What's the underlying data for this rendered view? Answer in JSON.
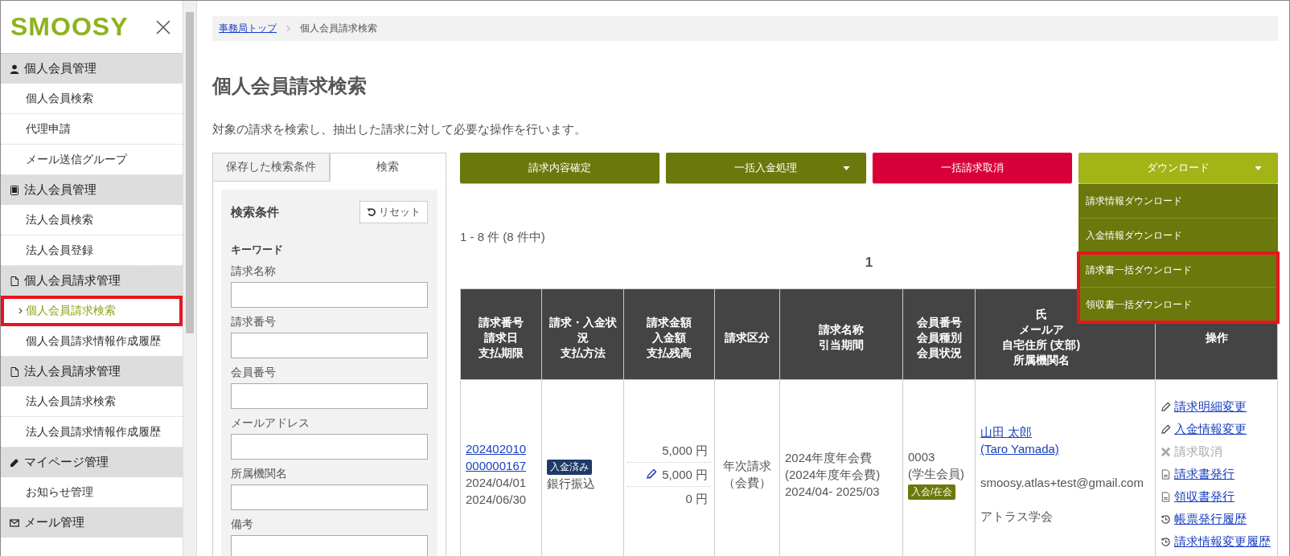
{
  "sidebar": {
    "logo": "SMOOSY",
    "sections": [
      {
        "title": "個人会員管理",
        "items": [
          {
            "label": "個人会員検索",
            "selected": false,
            "highlighted": false
          },
          {
            "label": "代理申請",
            "selected": false,
            "highlighted": false
          },
          {
            "label": "メール送信グループ",
            "selected": false,
            "highlighted": false
          }
        ]
      },
      {
        "title": "法人会員管理",
        "items": [
          {
            "label": "法人会員検索",
            "selected": false,
            "highlighted": false
          },
          {
            "label": "法人会員登録",
            "selected": false,
            "highlighted": false
          }
        ]
      },
      {
        "title": "個人会員請求管理",
        "items": [
          {
            "label": "個人会員請求検索",
            "selected": true,
            "highlighted": true
          },
          {
            "label": "個人会員請求情報作成履歴",
            "selected": false,
            "highlighted": false
          }
        ]
      },
      {
        "title": "法人会員請求管理",
        "items": [
          {
            "label": "法人会員請求検索",
            "selected": false,
            "highlighted": false
          },
          {
            "label": "法人会員請求情報作成履歴",
            "selected": false,
            "highlighted": false
          }
        ]
      },
      {
        "title": "マイページ管理",
        "items": [
          {
            "label": "お知らせ管理",
            "selected": false,
            "highlighted": false
          }
        ]
      },
      {
        "title": "メール管理"
      }
    ]
  },
  "breadcrumb": [
    {
      "label": "事務局トップ",
      "kind": "link"
    },
    {
      "label": "個人会員請求検索",
      "kind": "current"
    }
  ],
  "page_title": "個人会員請求検索",
  "description": "対象の請求を検索し、抽出した請求に対して必要な操作を行います。",
  "search_panel": {
    "tabs": [
      {
        "label": "保存した検索条件",
        "selected": false
      },
      {
        "label": "検索",
        "selected": true
      }
    ],
    "heading": "検索条件",
    "reset_button": "リセット",
    "group_label": "キーワード",
    "fields": [
      {
        "label": "請求名称"
      },
      {
        "label": "請求番号"
      },
      {
        "label": "会員番号"
      },
      {
        "label": "メールアドレス"
      },
      {
        "label": "所属機関名"
      },
      {
        "label": "備考"
      }
    ]
  },
  "actions": [
    {
      "label": "請求内容確定",
      "kind": "primary",
      "dropdown": false
    },
    {
      "label": "一括入金処理",
      "kind": "primary",
      "dropdown": true
    },
    {
      "label": "一括請求取消",
      "kind": "danger",
      "dropdown": false
    },
    {
      "label": "ダウンロード",
      "kind": "light",
      "dropdown": true,
      "expanded": true
    }
  ],
  "download_menu": [
    {
      "label": "請求情報ダウンロード",
      "highlighted": false
    },
    {
      "label": "入金情報ダウンロード",
      "highlighted": false
    },
    {
      "label": "請求書一括ダウンロード",
      "highlighted": true
    },
    {
      "label": "領収書一括ダウンロード",
      "highlighted": true
    }
  ],
  "result_count": "1 - 8 件 (8 件中)",
  "pagination": [
    {
      "label": "1",
      "selected": true
    }
  ],
  "table": {
    "columns": [
      {
        "lines": [
          "請求番号",
          "請求日",
          "支払期限"
        ]
      },
      {
        "lines": [
          "請求・入金状況",
          "支払方法"
        ]
      },
      {
        "lines": [
          "請求金額",
          "入金額",
          "支払残高"
        ]
      },
      {
        "lines": [
          "請求区分"
        ]
      },
      {
        "lines": [
          "請求名称",
          "引当期間"
        ]
      },
      {
        "lines": [
          "会員番号",
          "会員種別",
          "会員状況"
        ]
      },
      {
        "lines": [
          "氏",
          "メールア",
          "自宅住所 (支部)",
          "所属機関名"
        ]
      },
      {
        "lines": [
          "操作"
        ]
      }
    ],
    "rows": [
      {
        "invoice_no": "202402010000000167",
        "invoice_date": "2024/04/01",
        "due_date": "2024/06/30",
        "status_badge": "入金済み",
        "payment_method": "銀行振込",
        "amounts": [
          {
            "value": "5,000 円",
            "edited": false
          },
          {
            "value": "5,000 円",
            "edited": true
          },
          {
            "value": "0 円",
            "edited": false
          }
        ],
        "category": [
          "年次請求",
          "（会費）"
        ],
        "billing_name": "2024年度年会費",
        "billing_name_sub": "(2024年度年会費)",
        "period": "2024/04- 2025/03",
        "member_no": "0003",
        "member_type": "(学生会員)",
        "member_status": "入会/在会",
        "name": "山田 太郎",
        "name_en": "(Taro Yamada)",
        "email": "smoosy.atlas+test@gmail.com",
        "organization": "アトラス学会",
        "operations": [
          {
            "label": "請求明細変更",
            "kind": "edit",
            "disabled": false
          },
          {
            "label": "入金情報変更",
            "kind": "edit",
            "disabled": false
          },
          {
            "label": "請求取消",
            "kind": "cancel",
            "disabled": true
          },
          {
            "label": "請求書発行",
            "kind": "document",
            "disabled": false
          },
          {
            "label": "領収書発行",
            "kind": "document",
            "disabled": false
          },
          {
            "label": "帳票発行履歴",
            "kind": "history",
            "disabled": false
          },
          {
            "label": "請求情報変更履歴",
            "kind": "history",
            "disabled": false
          }
        ]
      }
    ]
  }
}
